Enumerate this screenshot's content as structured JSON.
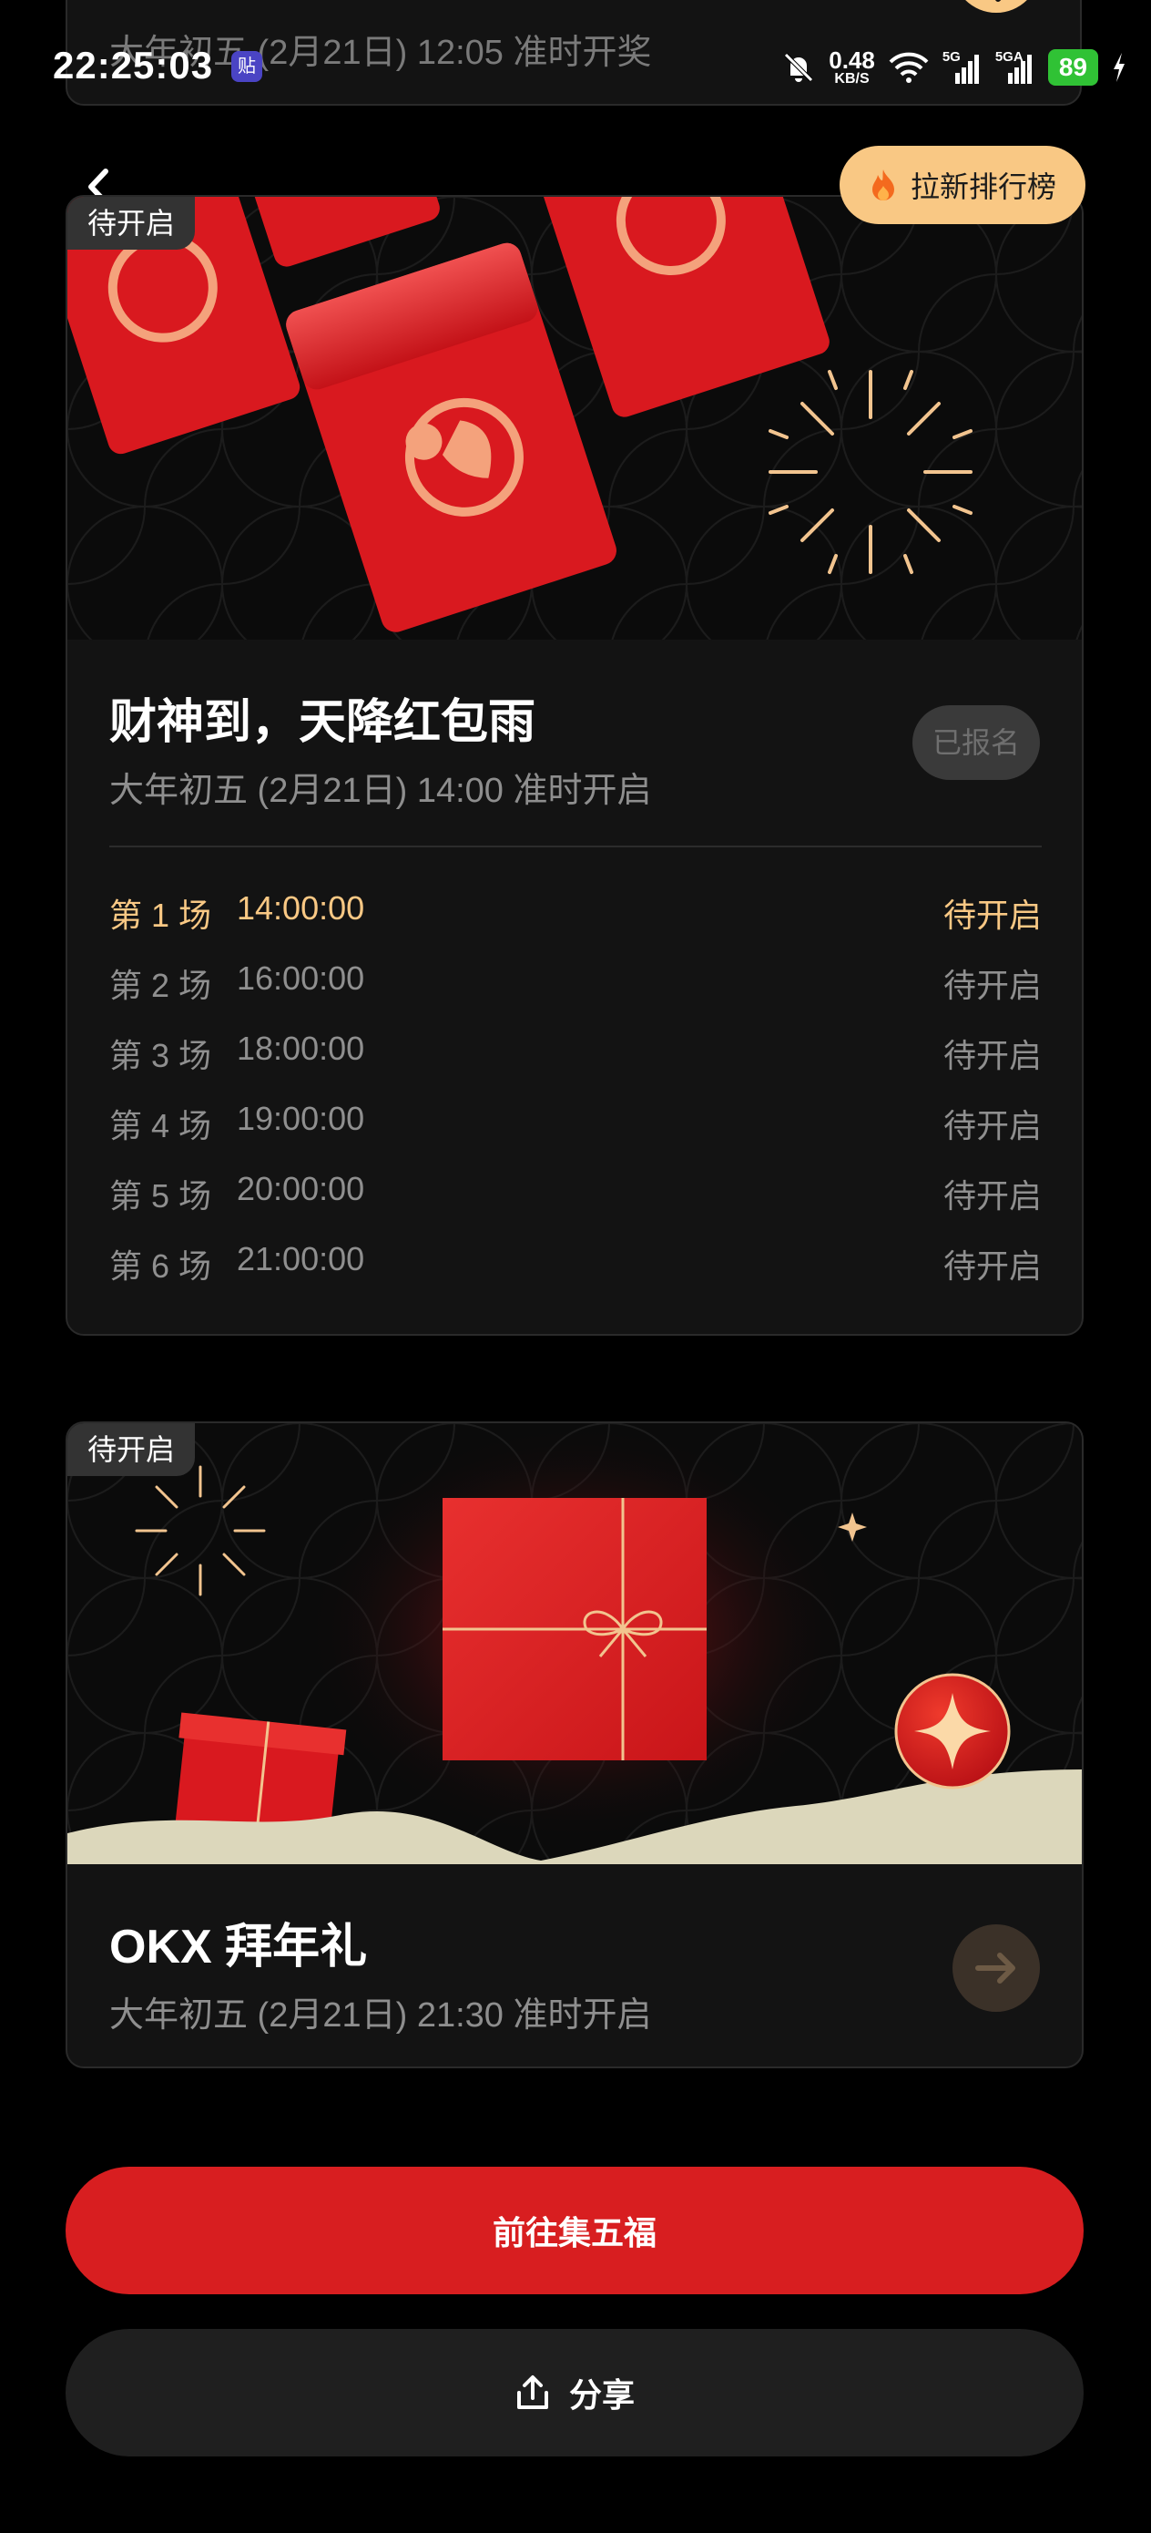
{
  "status_bar": {
    "time": "22:25:03",
    "app_badge": "贴",
    "net_speed": "0.48",
    "net_unit": "KB/S",
    "signal1": "5G",
    "signal2": "5GA",
    "battery": "89"
  },
  "top_card": {
    "subtitle": "大年初五 (2月21日) 12:05 准时开奖"
  },
  "header": {
    "leaderboard_label": "拉新排行榜"
  },
  "event1": {
    "tag": "待开启",
    "title": "财神到，天降红包雨",
    "subtitle": "大年初五 (2月21日) 14:00 准时开启",
    "registered_label": "已报名",
    "rounds": [
      {
        "label": "第 1 场",
        "time": "14:00:00",
        "state": "待开启"
      },
      {
        "label": "第 2 场",
        "time": "16:00:00",
        "state": "待开启"
      },
      {
        "label": "第 3 场",
        "time": "18:00:00",
        "state": "待开启"
      },
      {
        "label": "第 4 场",
        "time": "19:00:00",
        "state": "待开启"
      },
      {
        "label": "第 5 场",
        "time": "20:00:00",
        "state": "待开启"
      },
      {
        "label": "第 6 场",
        "time": "21:00:00",
        "state": "待开启"
      }
    ]
  },
  "event2": {
    "tag": "待开启",
    "title": "OKX 拜年礼",
    "subtitle": "大年初五 (2月21日) 21:30 准时开启"
  },
  "actions": {
    "primary_label": "前往集五福",
    "share_label": "分享"
  },
  "colors": {
    "accent_gold": "#f9c884",
    "primary_red": "#d81e20",
    "card_bg": "#131313"
  }
}
